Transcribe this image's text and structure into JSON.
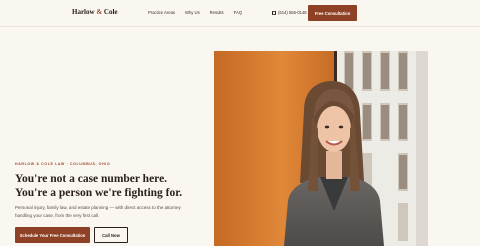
{
  "nav": {
    "brand_name_a": "Harlow",
    "brand_amp": "&",
    "brand_name_b": "Cole",
    "links": [
      "Practice Areas",
      "Why Us",
      "Results",
      "FAQ"
    ],
    "phone": "(614) 555-0148",
    "phone_icon": "phone-icon",
    "cta": "Free Consultation"
  },
  "hero": {
    "eyebrow": "HARLOW & COLE LAW · COLUMBUS, OHIO",
    "headline_line1": "You're not a case number here.",
    "headline_line2": "You're a person we're fighting for.",
    "subtext": "Personal injury, family law, and estate planning — with direct access to the attorney handling your case, from the very first call.",
    "primary_cta": "Schedule Your Free Consultation",
    "secondary_cta": "Call Now"
  },
  "colors": {
    "accent": "#8f4126",
    "background": "#faf6f0",
    "text": "#2a211c",
    "photo_wall": "#d0782e"
  }
}
